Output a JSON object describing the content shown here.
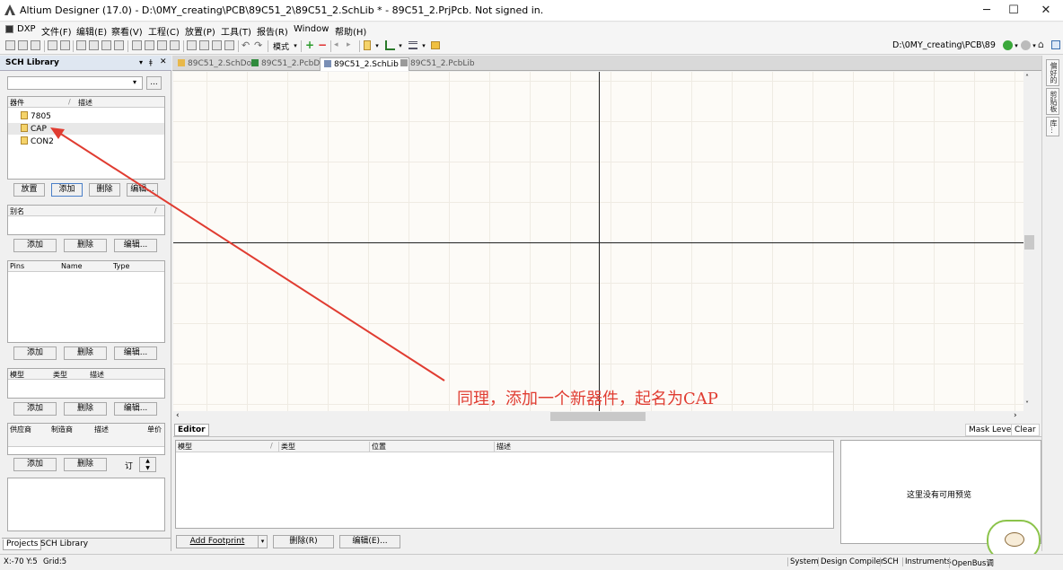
{
  "window": {
    "title": "Altium Designer (17.0) - D:\\0MY_creating\\PCB\\89C51_2\\89C51_2.SchLib * - 89C51_2.PrjPcb. Not signed in.",
    "minimize": "─",
    "maximize": "☐",
    "close": "✕"
  },
  "menu": [
    "DXP",
    "文件(F)",
    "编辑(E)",
    "察看(V)",
    "工程(C)",
    "放置(P)",
    "工具(T)",
    "报告(R)",
    "Window",
    "帮助(H)"
  ],
  "toolbar": {
    "mode_label": "模式",
    "path_value": "D:\\0MY_creating\\PCB\\89"
  },
  "sch_library": {
    "title": "SCH Library",
    "search_value": "",
    "search_more": "...",
    "components": {
      "headers": [
        "器件",
        "描述"
      ],
      "items": [
        "7805",
        "CAP",
        "CON2"
      ],
      "selected": "CAP"
    },
    "component_buttons": [
      "放置",
      "添加",
      "删除",
      "编辑..."
    ],
    "alias": {
      "header": "别名",
      "buttons": [
        "添加",
        "删除",
        "编辑..."
      ]
    },
    "pins": {
      "headers": [
        "Pins",
        "Name",
        "Type"
      ],
      "buttons": [
        "添加",
        "删除",
        "编辑..."
      ]
    },
    "models": {
      "headers": [
        "模型",
        "类型",
        "描述"
      ],
      "buttons": [
        "添加",
        "删除",
        "编辑..."
      ]
    },
    "suppliers": {
      "headers": [
        "供应商",
        "制造商",
        "描述",
        "单价"
      ],
      "buttons": [
        "添加",
        "删除"
      ],
      "order_label": "订"
    },
    "bottom_tabs": [
      "Projects",
      "SCH Library"
    ]
  },
  "doc_tabs": [
    {
      "label": "89C51_2.SchDoc",
      "active": false,
      "icon_color": "#e8b84a"
    },
    {
      "label": "89C51_2.PcbDoc",
      "active": false,
      "icon_color": "#2f8a3c"
    },
    {
      "label": "89C51_2.SchLib *",
      "active": true,
      "icon_color": "#7a8fb5"
    },
    {
      "label": "89C51_2.PcbLib",
      "active": false,
      "icon_color": "#9a9a9a"
    }
  ],
  "right_panel_tabs": [
    "偏好的",
    "剪贴板",
    "库..."
  ],
  "editor": {
    "title": "Editor",
    "mask_level": "Mask Level",
    "clear": "Clear",
    "headers": [
      "模型",
      "类型",
      "位置",
      "描述"
    ],
    "preview_text": "这里没有可用预览",
    "add_footprint": "Add Footprint",
    "delete_btn": "删除(R)",
    "edit_btn": "编辑(E)..."
  },
  "status": {
    "coords": "X:-70 Y:5",
    "grid": "Grid:5",
    "panels": [
      "System",
      "Design Compiler",
      "SCH",
      "Instruments",
      "OpenBus调"
    ]
  },
  "annotation": {
    "text": "同理，添加一个新器件，起名为CAP",
    "color": "#e03c31"
  }
}
